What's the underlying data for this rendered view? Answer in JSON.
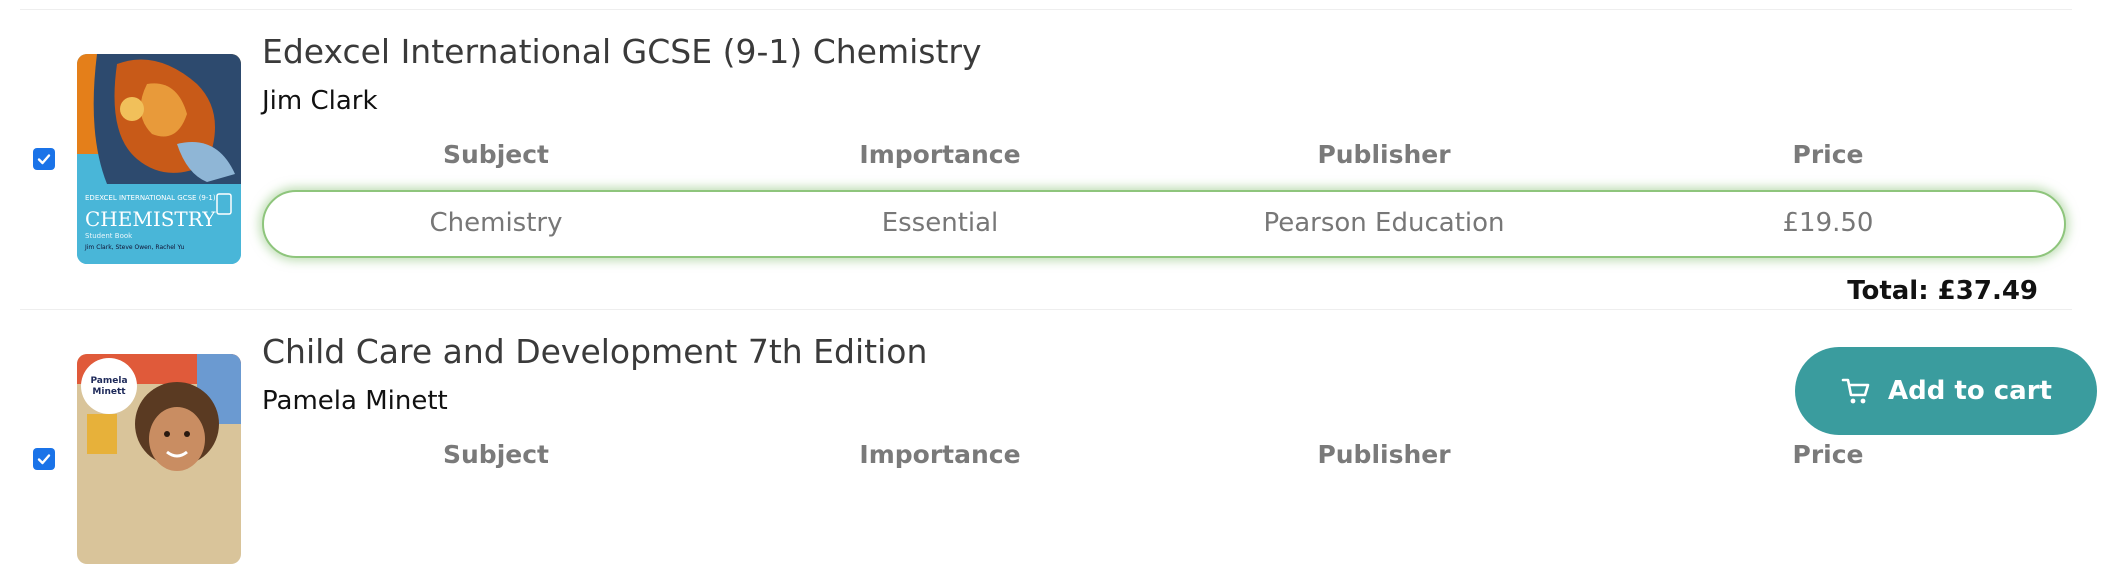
{
  "columns": {
    "subject": "Subject",
    "importance": "Importance",
    "publisher": "Publisher",
    "price": "Price"
  },
  "books": [
    {
      "title": "Edexcel International GCSE (9-1) Chemistry",
      "author": "Jim Clark",
      "checked": true,
      "subject": "Chemistry",
      "importance": "Essential",
      "publisher": "Pearson Education",
      "price": "£19.50",
      "cover": {
        "series": "EDEXCEL INTERNATIONAL GCSE (9-1)",
        "name": "CHEMISTRY",
        "subtitle": "Student Book",
        "authors": "Jim Clark, Steve Owen, Rachel Yu",
        "colors": {
          "top": "#e47f1a",
          "bottom": "#49b6d8",
          "swirl": "#2d4a6e"
        }
      }
    },
    {
      "title": "Child Care and Development 7th Edition",
      "author": "Pamela Minett",
      "checked": true,
      "cover": {
        "badge": "Pamela Minett"
      }
    }
  ],
  "total": "Total: £37.49",
  "cart_button": {
    "label": "Add to cart",
    "icon": "cart-icon",
    "color": "#3a9c9e"
  },
  "accent_colors": {
    "checkbox": "#1a73e8",
    "highlight": "#8ec57c"
  }
}
